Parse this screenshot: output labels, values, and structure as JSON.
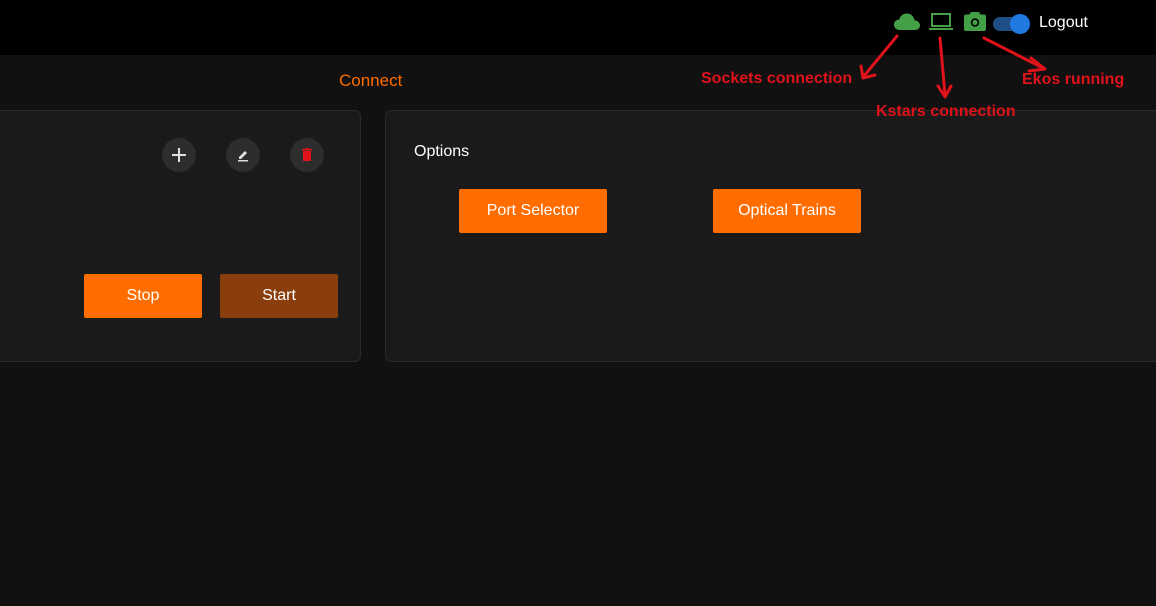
{
  "header": {
    "icons": {
      "sockets": "cloud-icon",
      "kstars": "laptop-icon",
      "ekos": "camera-icon"
    },
    "status_color": "#43a047",
    "toggle_on": true,
    "logout_label": "Logout"
  },
  "page": {
    "tab_title": "Connect"
  },
  "profile_card": {
    "actions": [
      "add-icon",
      "edit-icon",
      "delete-icon"
    ],
    "stop_label": "Stop",
    "start_label": "Start"
  },
  "options_card": {
    "title": "Options",
    "port_selector_label": "Port Selector",
    "optical_trains_label": "Optical Trains"
  },
  "annotations": {
    "sockets": "Sockets connection",
    "kstars": "Kstars connection",
    "ekos": "Ekos running",
    "color": "#e0121a"
  },
  "colors": {
    "accent": "#ff6d00",
    "accent_dark": "#8a3e0c",
    "delete": "#e0121a",
    "toggle": "#1f7ae0"
  }
}
